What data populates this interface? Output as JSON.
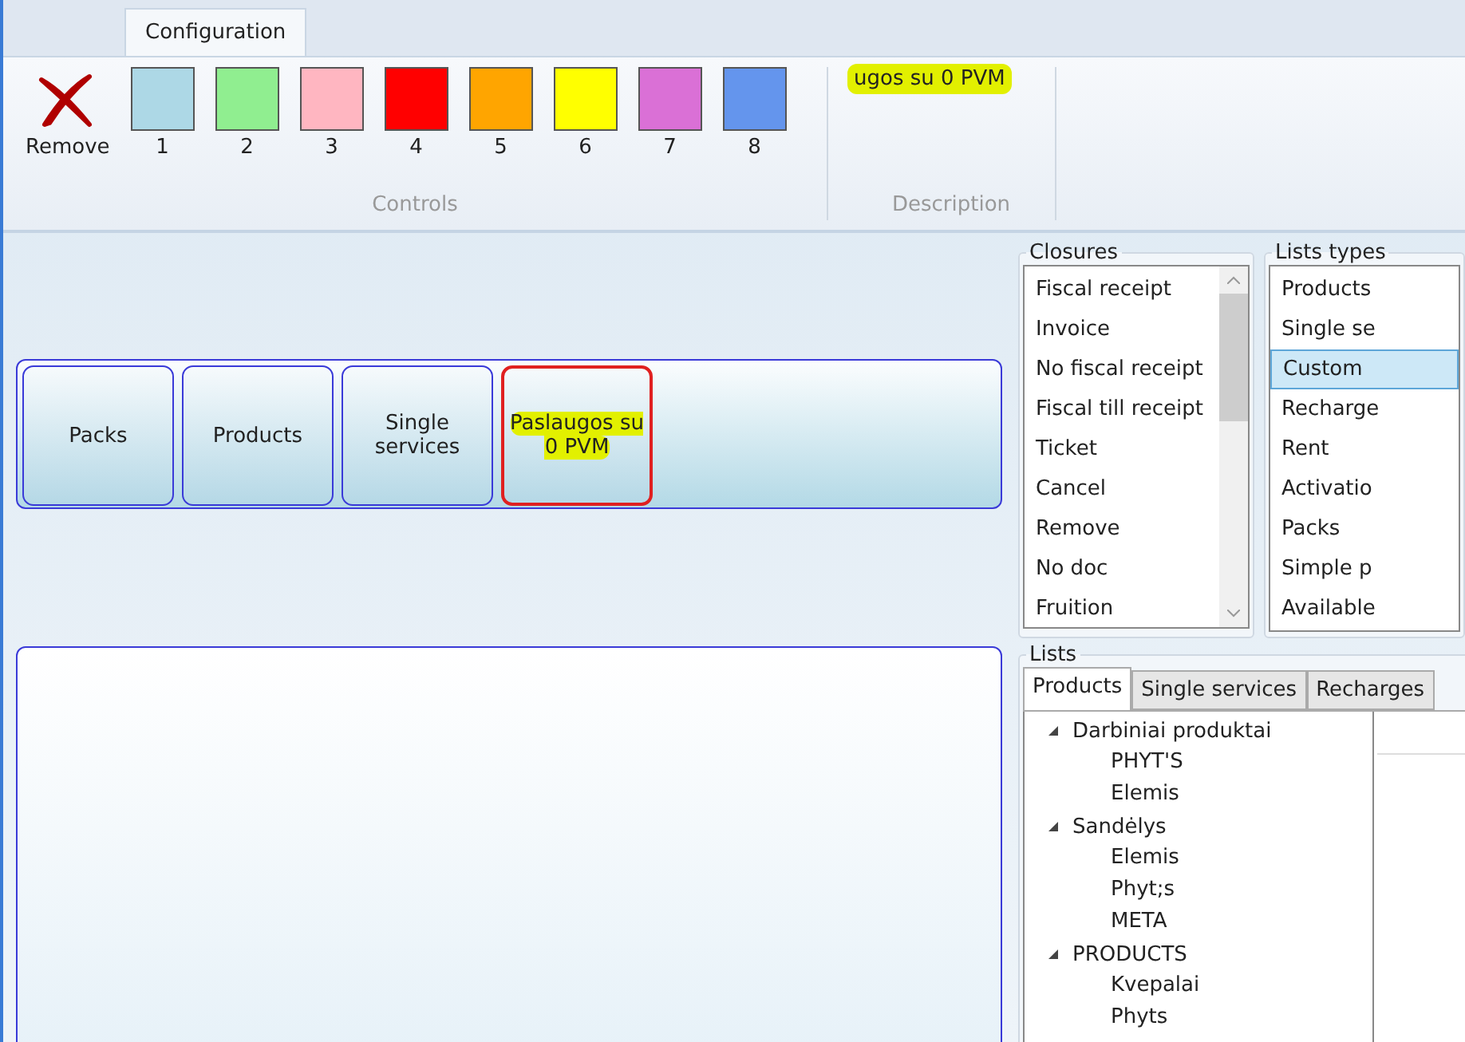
{
  "ribbon": {
    "tab": "Configuration",
    "remove_label": "Remove",
    "swatches": [
      {
        "label": "1",
        "color": "#add8e6"
      },
      {
        "label": "2",
        "color": "#90ee90"
      },
      {
        "label": "3",
        "color": "#ffb6c1"
      },
      {
        "label": "4",
        "color": "#ff0000"
      },
      {
        "label": "5",
        "color": "#ffa500"
      },
      {
        "label": "6",
        "color": "#ffff00"
      },
      {
        "label": "7",
        "color": "#da70d6"
      },
      {
        "label": "8",
        "color": "#6495ed"
      }
    ],
    "controls_caption": "Controls",
    "description_value": "ugos su 0 PVM",
    "description_highlighted": true,
    "description_caption": "Description"
  },
  "list_buttons": [
    {
      "label": "Packs",
      "selected": false,
      "highlighted": false
    },
    {
      "label": "Products",
      "selected": false,
      "highlighted": false
    },
    {
      "label": "Single services",
      "selected": false,
      "highlighted": false
    },
    {
      "label": "Paslaugos su 0 PVM",
      "selected": true,
      "highlighted": true
    }
  ],
  "closures": {
    "title": "Closures",
    "items": [
      "Fiscal receipt",
      "Invoice",
      "No fiscal receipt",
      "Fiscal till receipt",
      "Ticket",
      "Cancel",
      "Remove",
      "No doc",
      "Fruition"
    ]
  },
  "lists_types": {
    "title": "Lists types",
    "items": [
      {
        "label": "Products",
        "selected": false
      },
      {
        "label": "Single se",
        "selected": false
      },
      {
        "label": "Custom",
        "selected": true
      },
      {
        "label": "Recharge",
        "selected": false
      },
      {
        "label": "Rent",
        "selected": false
      },
      {
        "label": "Activatio",
        "selected": false
      },
      {
        "label": "Packs",
        "selected": false
      },
      {
        "label": "Simple p",
        "selected": false
      },
      {
        "label": "Available",
        "selected": false
      }
    ]
  },
  "lists": {
    "title": "Lists",
    "tabs": [
      {
        "label": "Products",
        "selected": true
      },
      {
        "label": "Single services",
        "selected": false
      },
      {
        "label": "Recharges",
        "selected": false
      }
    ],
    "tree": [
      {
        "label": "Darbiniai produktai",
        "expanded": true,
        "children": [
          {
            "label": "PHYT'S"
          },
          {
            "label": "Elemis"
          }
        ]
      },
      {
        "label": "Sandėlys",
        "expanded": true,
        "children": [
          {
            "label": "Elemis"
          },
          {
            "label": "Phyt;s"
          },
          {
            "label": "META"
          }
        ]
      },
      {
        "label": "PRODUCTS",
        "expanded": true,
        "children": [
          {
            "label": "Kvepalai"
          },
          {
            "label": "Phyts"
          }
        ]
      }
    ]
  }
}
